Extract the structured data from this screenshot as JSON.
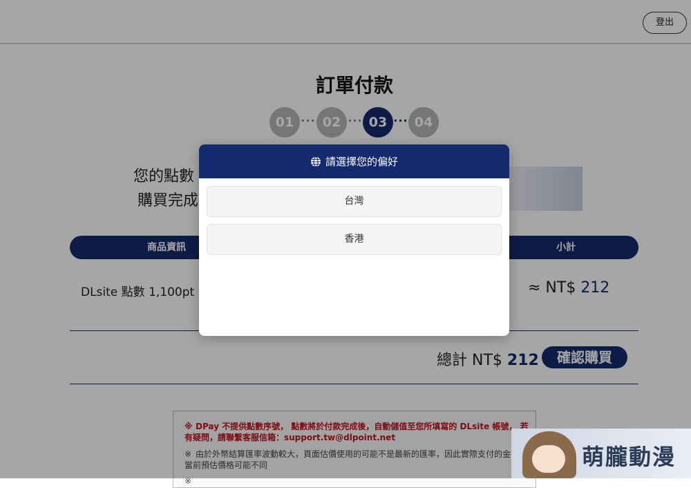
{
  "header": {
    "logout_label": "登出"
  },
  "page": {
    "title": "訂單付款",
    "steps": [
      "01",
      "02",
      "03",
      "04"
    ],
    "info_line1": "您的點數",
    "info_line2": "購買完成"
  },
  "table": {
    "col_product": "商品資訊",
    "col_subtotal": "小計",
    "item_name": "DLsite 點數 1,100pt",
    "item_price_prefix": "≈ NT$ ",
    "item_price_value": "212"
  },
  "total": {
    "label": "總計 NT$ ",
    "value": "212",
    "confirm_label": "確認購買"
  },
  "notices": {
    "mark": "※",
    "red_text": "DPay 不提供點數序號， 點數將於付款完成後，自動儲值至您所填寫的 DLsite 帳號， 若有疑問，請聯繫客服信箱：support.tw@dlpoint.net",
    "grey_text": "由於外幣結算匯率波動較大，頁面估價使用的可能不是最新的匯率，因此實際支付的金額與當前預估價格可能不同"
  },
  "modal": {
    "title": "請選擇您的偏好",
    "option_taiwan": "台灣",
    "option_hongkong": "香港"
  },
  "watermark": {
    "text": "萌朧動漫"
  },
  "colors": {
    "primary": "#142a6e",
    "alert_red": "#c0141e",
    "step_inactive": "#b5b5b5"
  }
}
